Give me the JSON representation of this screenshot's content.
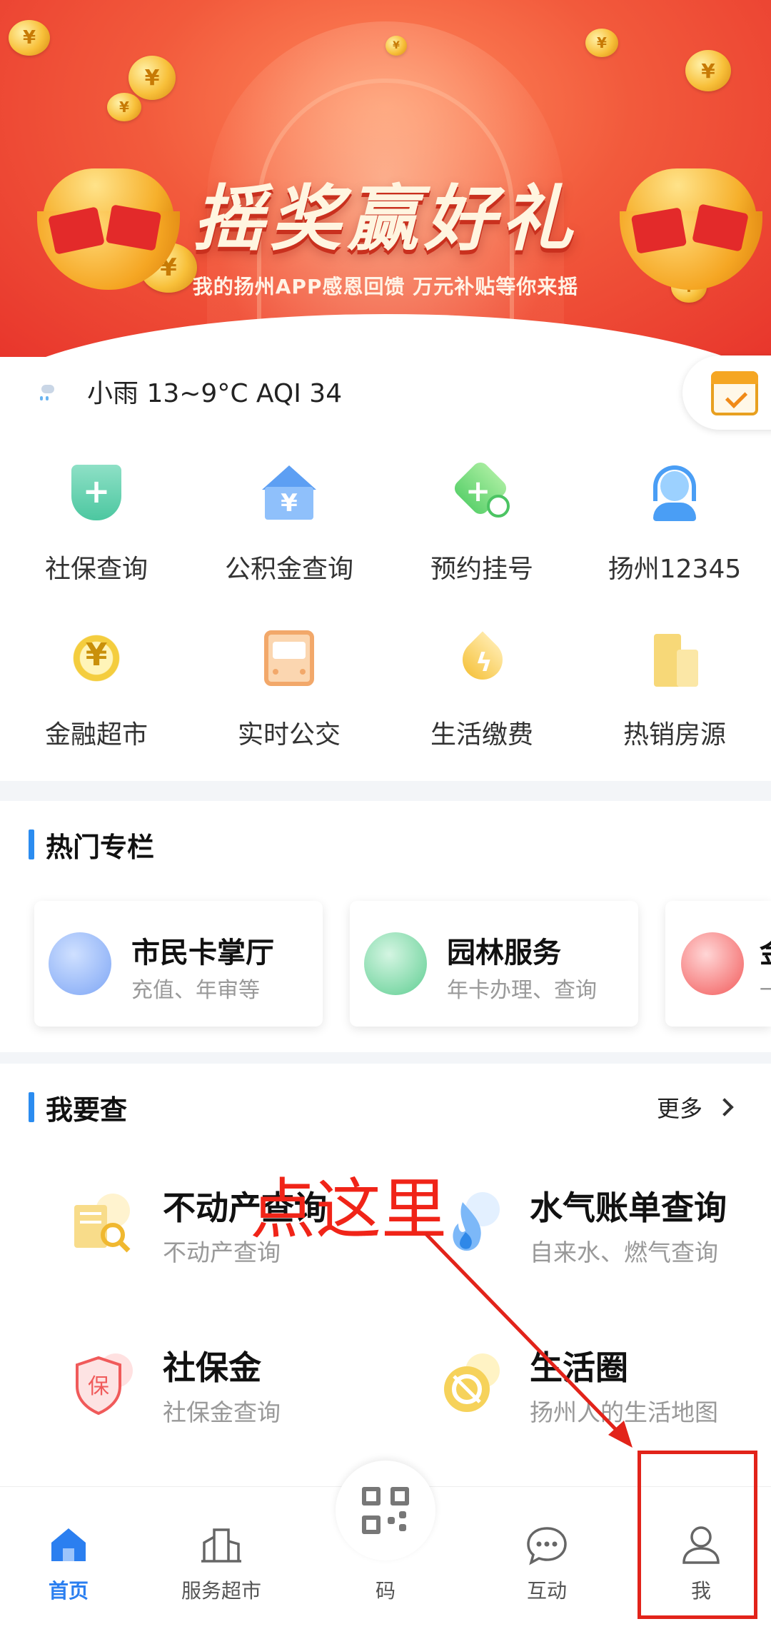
{
  "banner": {
    "title": "摇奖赢好礼",
    "subtitle": "我的扬州APP感恩回馈 万元补贴等你来摇"
  },
  "weather": {
    "text": "小雨 13~9°C AQI 34",
    "icon": "rain-cloud-icon"
  },
  "services": [
    {
      "label": "社保查询",
      "icon": "social-security-icon"
    },
    {
      "label": "公积金查询",
      "icon": "housing-fund-icon"
    },
    {
      "label": "预约挂号",
      "icon": "appointment-icon"
    },
    {
      "label": "扬州12345",
      "icon": "hotline-icon"
    },
    {
      "label": "金融超市",
      "icon": "finance-icon"
    },
    {
      "label": "实时公交",
      "icon": "bus-icon"
    },
    {
      "label": "生活缴费",
      "icon": "utility-payment-icon"
    },
    {
      "label": "热销房源",
      "icon": "building-icon"
    }
  ],
  "hot_section": {
    "title": "热门专栏",
    "cards": [
      {
        "title": "市民卡掌厅",
        "subtitle": "充值、年审等",
        "icon": "citizen-card-icon",
        "color": "#5b8ef0"
      },
      {
        "title": "园林服务",
        "subtitle": "年卡办理、查询",
        "icon": "tree-icon",
        "color": "#3cbf78"
      },
      {
        "title": "金",
        "subtitle": "一",
        "icon": "money-bag-icon",
        "color": "#f25a5a"
      }
    ]
  },
  "query_section": {
    "title": "我要查",
    "more": "更多",
    "items": [
      {
        "title": "不动产查询",
        "subtitle": "不动产查询",
        "icon": "property-icon"
      },
      {
        "title": "水气账单查询",
        "subtitle": "自来水、燃气查询",
        "icon": "flame-icon"
      },
      {
        "title": "社保金",
        "subtitle": "社保金查询",
        "icon": "insurance-icon"
      },
      {
        "title": "生活圈",
        "subtitle": "扬州人的生活地图",
        "icon": "life-circle-icon"
      }
    ]
  },
  "annotation": {
    "text": "点这里",
    "color": "#f02418"
  },
  "tabbar": {
    "items": [
      {
        "label": "首页",
        "icon": "home-icon",
        "active": true
      },
      {
        "label": "服务超市",
        "icon": "city-icon",
        "active": false
      },
      {
        "label": "码",
        "icon": "qr-code-icon",
        "active": false
      },
      {
        "label": "互动",
        "icon": "chat-icon",
        "active": false
      },
      {
        "label": "我",
        "icon": "user-icon",
        "active": false
      }
    ],
    "accent": "#2b7ff0"
  }
}
